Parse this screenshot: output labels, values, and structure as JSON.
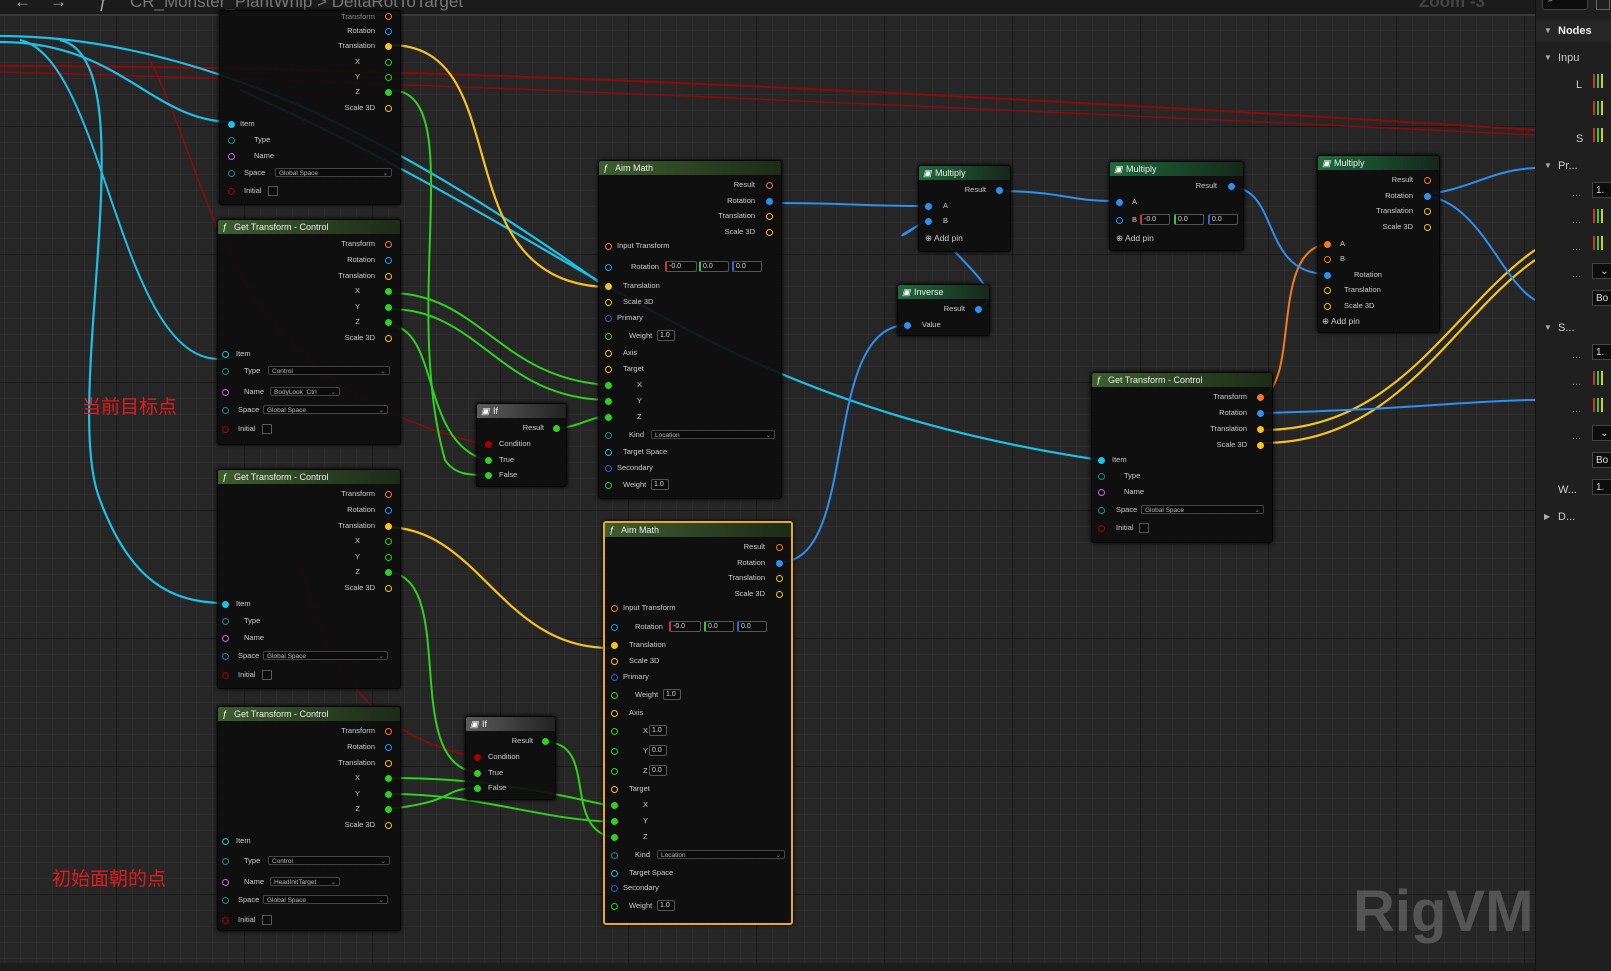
{
  "header": {
    "back_icon": "←",
    "forward_icon": "→",
    "func_icon": "ƒ",
    "breadcrumb": "CR_Monster_PlantWhip > DeltaRotToTarget",
    "zoom": "Zoom -3"
  },
  "annotations": {
    "current_target": "当前目标点",
    "initial_facing": "初始面朝的点"
  },
  "watermark": "RigVM",
  "common": {
    "transform": "Transform",
    "rotation": "Rotation",
    "translation": "Translation",
    "x": "X",
    "y": "Y",
    "z": "Z",
    "scale3d": "Scale 3D",
    "item": "Item",
    "type": "Type",
    "name": "Name",
    "space": "Space",
    "initial": "Initial",
    "result": "Result",
    "condition": "Condition",
    "true": "True",
    "false": "False",
    "a": "A",
    "b": "B",
    "value": "Value",
    "add_pin": "Add pin",
    "input_transform": "Input Transform",
    "primary": "Primary",
    "weight": "Weight",
    "axis": "Axis",
    "target": "Target",
    "kind": "Kind",
    "target_space": "Target Space",
    "secondary": "Secondary",
    "global_space": "Global Space",
    "control": "Control",
    "location": "Location",
    "one": "1.0",
    "zero": "0.0",
    "negzero": "-0.0"
  },
  "nodes": {
    "get1": {
      "title": "Get Transform - Control"
    },
    "get2": {
      "title": "Get Transform - Control",
      "name": "BodyLook_Ctrl"
    },
    "get3": {
      "title": "Get Transform - Control"
    },
    "get4": {
      "title": "Get Transform - Control",
      "name": "HeadInitTarget"
    },
    "get5": {
      "title": "Get Transform - Control"
    },
    "if1": {
      "title": "If"
    },
    "if2": {
      "title": "If"
    },
    "aim1": {
      "title": "Aim Math"
    },
    "aim2": {
      "title": "Aim Math"
    },
    "mul1": {
      "title": "Multiply"
    },
    "mul2": {
      "title": "Multiply"
    },
    "mul3": {
      "title": "Multiply"
    },
    "inverse": {
      "title": "Inverse"
    }
  },
  "details_panel": {
    "nodes_label": "Nodes",
    "inputs_label": "Inpu",
    "l_label": "L",
    "s_label": "S",
    "pr_label": "Pr...",
    "s_section": "S...",
    "w_label": "W...",
    "d_label": "D...",
    "val_one": "1.",
    "bo": "Bo",
    "dots": "..."
  },
  "colors": {
    "bool": "#a70000",
    "float": "#2fd11e",
    "vector": "#f4c224",
    "rotator": "#2d8ff0",
    "transform": "#f07a24",
    "struct": "#1ec0e6",
    "name": "#c86ad8"
  }
}
